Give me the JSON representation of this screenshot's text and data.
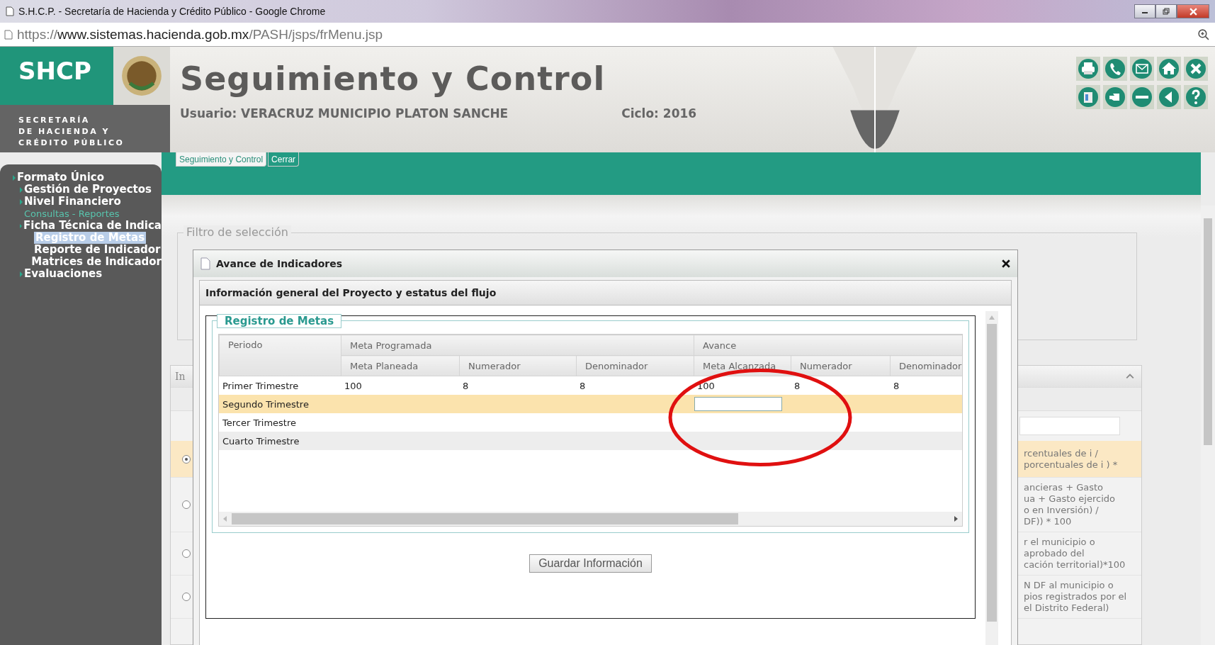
{
  "browser": {
    "title": "S.H.C.P. - Secretaría de Hacienda y Crédito Público - Google Chrome",
    "url_scheme": "https://",
    "url_host": "www.sistemas.hacienda.gob.mx",
    "url_path": "/PASH/jsps/frMenu.jsp"
  },
  "header": {
    "logo": "SHCP",
    "agency_lines": [
      "SECRETARÍA",
      "DE HACIENDA Y",
      "CRÉDITO PÚBLICO"
    ],
    "title": "Seguimiento y Control",
    "user": "Usuario: VERACRUZ MUNICIPIO PLATON SANCHE",
    "cycle": "Ciclo: 2016"
  },
  "tabs": [
    {
      "label": "Seguimiento y Control",
      "selected": true
    },
    {
      "label": "Cerrar",
      "selected": false
    }
  ],
  "sidebar": {
    "items": [
      {
        "label": "Formato Único",
        "kind": "folder",
        "selected": false,
        "children": [
          {
            "label": "Gestión de Proyectos",
            "kind": "folder",
            "selected": false
          },
          {
            "label": "Nivel Financiero",
            "kind": "folder",
            "selected": false
          },
          {
            "label": "Consultas - Reportes",
            "kind": "link",
            "selected": false
          },
          {
            "label": "Ficha Técnica de Indica",
            "kind": "folder",
            "selected": false,
            "children": [
              {
                "label": "Registro de Metas",
                "kind": "page",
                "selected": true
              },
              {
                "label": "Reporte de Indicador",
                "kind": "page",
                "selected": false
              },
              {
                "label": "Matrices de Indicador",
                "kind": "page",
                "selected": false
              }
            ]
          },
          {
            "label": "Evaluaciones",
            "kind": "folder",
            "selected": false
          }
        ]
      }
    ]
  },
  "filter": {
    "legend": "Filtro de selección"
  },
  "indicator_panel": {
    "label": "In",
    "rows": [
      {
        "selected": true,
        "lines": [
          "rcentuales de i /",
          "porcentuales de i ) *"
        ]
      },
      {
        "selected": false,
        "lines": [
          "ancieras + Gasto",
          "ua + Gasto ejercido",
          "o en Inversión) /",
          "DF)) * 100"
        ]
      },
      {
        "selected": false,
        "lines": [
          "r el municipio o",
          "aprobado del",
          "cación territorial)*100"
        ]
      },
      {
        "selected": false,
        "lines": [
          "N DF al municipio o",
          "pios registrados por el",
          "el Distrito Federal)"
        ]
      }
    ]
  },
  "dialog": {
    "title": "Avance de Indicadores",
    "section": "Información general del Proyecto y estatus del flujo",
    "fieldset": "Registro de Metas",
    "table": {
      "period_header": "Periodo",
      "groups": [
        "Meta Programada",
        "Avance"
      ],
      "columns": [
        "Meta Planeada",
        "Numerador",
        "Denominador",
        "Meta Alcanzada",
        "Numerador",
        "Denominador"
      ],
      "rows": [
        {
          "period": "Primer Trimestre",
          "cells": [
            "100",
            "8",
            "8",
            "100",
            "8",
            "8"
          ],
          "selected": false,
          "editing": false
        },
        {
          "period": "Segundo Trimestre",
          "selected": true,
          "editing": true
        },
        {
          "period": "Tercer Trimestre",
          "selected": false,
          "editing": false
        },
        {
          "period": "Cuarto Trimestre",
          "selected": false,
          "editing": false
        }
      ]
    },
    "save_button": "Guardar Información"
  }
}
